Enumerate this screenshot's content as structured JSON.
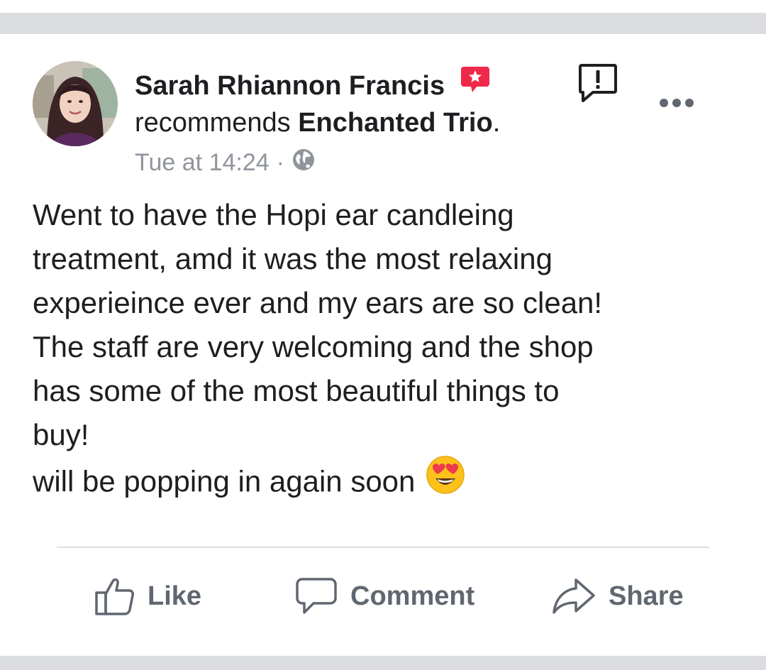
{
  "post": {
    "author_name": "Sarah Rhiannon Francis",
    "recommends_prefix": "recommends",
    "page_name": "Enchanted Trio",
    "recommends_suffix": ".",
    "timestamp": "Tue at 14:24",
    "separator": "·",
    "privacy_icon": "globe-icon",
    "badge_icon": "recommendation-star-icon",
    "body_lines": [
      "Went to have the Hopi ear candleing",
      "treatment, amd it was the most relaxing",
      "experieince ever and my ears are so clean!",
      "The staff are very welcoming and the shop",
      "has some of the most beautiful things to",
      "buy!",
      "will be popping in again soon"
    ],
    "trailing_emoji": "heart-eyes-emoji"
  },
  "actions": {
    "like_label": "Like",
    "comment_label": "Comment",
    "share_label": "Share"
  },
  "colors": {
    "text": "#1c1e21",
    "meta": "#90949c",
    "action": "#606770",
    "badge": "#f02849",
    "separator_bg": "#dcdde1"
  }
}
